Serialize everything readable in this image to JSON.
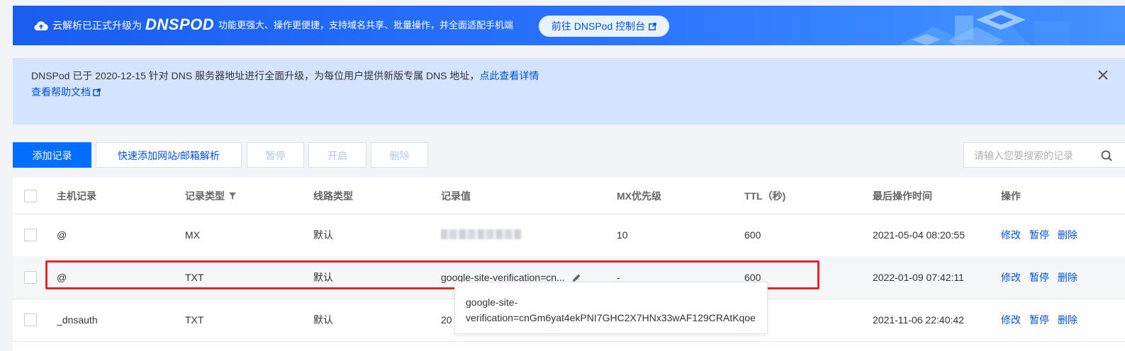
{
  "banner": {
    "upgrade_text": "云解析已正式升级为",
    "logo_text": "DNSPOD",
    "description": "功能更强大、操作更便捷，支持域名共享、批量操作，并全面适配手机端",
    "cta_label": "前往 DNSPod 控制台"
  },
  "notice": {
    "text": "DNSPod 已于 2020-12-15 针对 DNS 服务器地址进行全面升级，为每位用户提供新版专属 DNS 地址，",
    "detail_link": "点此查看详情",
    "help_link": "查看帮助文档"
  },
  "toolbar": {
    "add_record": "添加记录",
    "quick_add": "快速添加网站/邮箱解析",
    "pause": "暂停",
    "enable": "开启",
    "delete": "删除",
    "search_placeholder": "请输入您要搜索的记录"
  },
  "table": {
    "headers": {
      "host": "主机记录",
      "type": "记录类型",
      "line": "线路类型",
      "value": "记录值",
      "mx": "MX优先级",
      "ttl": "TTL（秒)",
      "time": "最后操作时间",
      "ops": "操作"
    },
    "rows": [
      {
        "host": "@",
        "type": "MX",
        "line": "默认",
        "value": "",
        "mx": "10",
        "ttl": "600",
        "time": "2021-05-04 08:20:55"
      },
      {
        "host": "@",
        "type": "TXT",
        "line": "默认",
        "value": "google-site-verification=cn...",
        "mx": "-",
        "ttl": "600",
        "time": "2022-01-09 07:42:11"
      },
      {
        "host": "_dnsauth",
        "type": "TXT",
        "line": "默认",
        "value": "20",
        "mx": "",
        "ttl": "",
        "time": "2021-11-06 22:40:42"
      }
    ],
    "actions": {
      "edit": "修改",
      "pause": "暂停",
      "delete": "删除"
    }
  },
  "tooltip": {
    "line1": "google-site-",
    "line2": "verification=cnGm6yat4ekPNI7GHC2X7HNx33wAF129CRAtKqoe"
  },
  "colors": {
    "primary": "#006eff",
    "link": "#0052d9",
    "notice_bg": "#d4e4ff",
    "highlight": "#e8242b"
  }
}
